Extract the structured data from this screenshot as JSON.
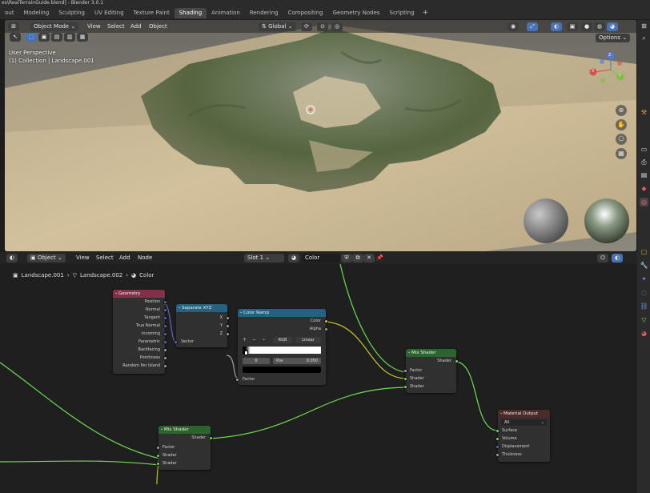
{
  "window": {
    "title": "es\\RealTerrainGuide.blend] - Blender 3.0.1"
  },
  "workspace_tabs": [
    {
      "label": "out",
      "active": false
    },
    {
      "label": "Modeling",
      "active": false
    },
    {
      "label": "Sculpting",
      "active": false
    },
    {
      "label": "UV Editing",
      "active": false
    },
    {
      "label": "Texture Paint",
      "active": false
    },
    {
      "label": "Shading",
      "active": true
    },
    {
      "label": "Animation",
      "active": false
    },
    {
      "label": "Rendering",
      "active": false
    },
    {
      "label": "Compositing",
      "active": false
    },
    {
      "label": "Geometry Nodes",
      "active": false
    },
    {
      "label": "Scripting",
      "active": false
    }
  ],
  "workspace_add": "+",
  "viewport": {
    "mode": "Object Mode",
    "menus": [
      "View",
      "Select",
      "Add",
      "Object"
    ],
    "orientation": "Global",
    "options": "Options",
    "overlay_text_1": "User Perspective",
    "overlay_text_2": "(1) Collection | Landscape.001",
    "gizmo_axes": {
      "z": "Z",
      "x": "X",
      "y": "Y"
    }
  },
  "node_editor": {
    "editor_type": "Object",
    "menus": [
      "View",
      "Select",
      "Add",
      "Node"
    ],
    "slot": "Slot 1",
    "material": "Color",
    "breadcrumb": [
      "Landscape.001",
      "Landscape.002",
      "Color"
    ],
    "nodes": {
      "geometry": {
        "title": "Geometry",
        "outputs": [
          "Position",
          "Normal",
          "Tangent",
          "True Normal",
          "Incoming",
          "Parametric",
          "Backfacing",
          "Pointiness",
          "Random Per Island"
        ]
      },
      "separate_xyz": {
        "title": "Separate XYZ",
        "outputs": [
          "X",
          "Y",
          "Z"
        ],
        "input": "Vector"
      },
      "color_ramp": {
        "title": "Color Ramp",
        "outputs": [
          "Color",
          "Alpha"
        ],
        "controls": {
          "add": "+",
          "remove": "−",
          "menu": "⌄",
          "color_mode": "RGB",
          "interpolation": "Linear"
        },
        "stop_index": "0",
        "pos_label": "Pos",
        "pos_value": "0.050",
        "input": "Factor"
      },
      "mix_shader_top": {
        "title": "Mix Shader",
        "output": "Shader",
        "inputs": [
          "Factor",
          "Shader",
          "Shader"
        ]
      },
      "mix_shader_bottom": {
        "title": "Mix Shader",
        "output": "Shader",
        "inputs": [
          "Factor",
          "Shader",
          "Shader"
        ]
      },
      "material_output": {
        "title": "Material Output",
        "target": "All",
        "inputs": [
          "Surface",
          "Volume",
          "Displacement",
          "Thickness"
        ]
      }
    }
  },
  "colors": {
    "input_node_header": "#83314a",
    "converter_node_header": "#246283",
    "shader_node_header": "#2b652b",
    "output_node_header": "#4b2a2a",
    "link_shader": "#6dde52",
    "link_color": "#c7c729",
    "link_vector": "#6363c7",
    "link_float": "#a1a1a1",
    "accent": "#4772b3"
  }
}
